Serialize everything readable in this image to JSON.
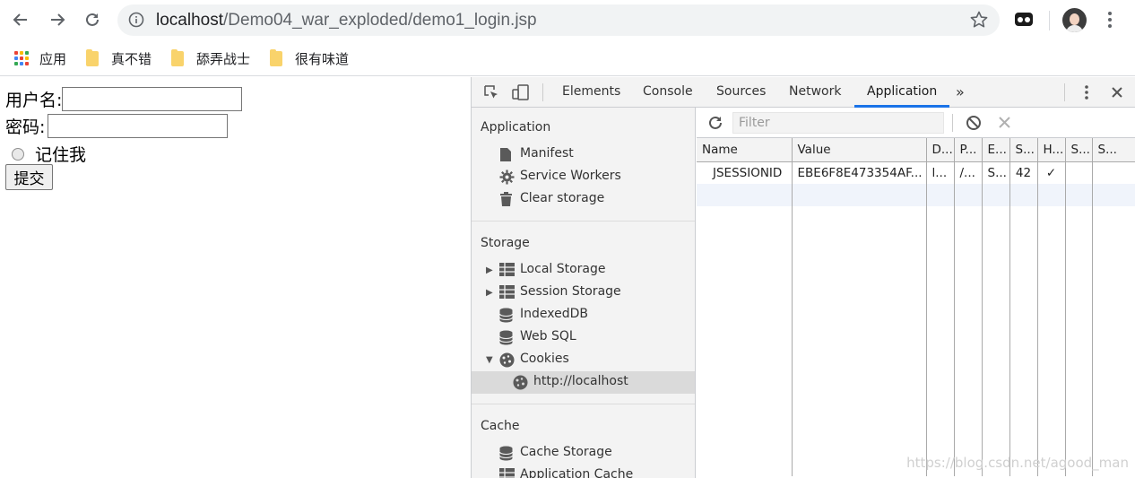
{
  "browser": {
    "url_host": "localhost",
    "url_path": "/Demo04_war_exploded/demo1_login.jsp",
    "bookmarks": [
      {
        "label": "应用",
        "icon": "apps-grid-icon"
      },
      {
        "label": "真不错",
        "icon": "folder-icon"
      },
      {
        "label": "舔弄战士",
        "icon": "folder-icon"
      },
      {
        "label": "很有味道",
        "icon": "folder-icon"
      }
    ]
  },
  "page": {
    "username_label": "用户名:",
    "password_label": "密码:",
    "remember_label": "记住我",
    "submit_label": "提交"
  },
  "devtools": {
    "tabs": [
      "Elements",
      "Console",
      "Sources",
      "Network",
      "Application"
    ],
    "active_tab": "Application",
    "sidebar": {
      "application": {
        "title": "Application",
        "items": [
          "Manifest",
          "Service Workers",
          "Clear storage"
        ]
      },
      "storage": {
        "title": "Storage",
        "items": [
          "Local Storage",
          "Session Storage",
          "IndexedDB",
          "Web SQL",
          "Cookies",
          "http://localhost"
        ]
      },
      "cache": {
        "title": "Cache",
        "items": [
          "Cache Storage",
          "Application Cache"
        ]
      }
    },
    "filter_placeholder": "Filter",
    "table": {
      "columns": [
        "Name",
        "Value",
        "D...",
        "P...",
        "E...",
        "S...",
        "H...",
        "S...",
        "S..."
      ],
      "rows": [
        [
          "JSESSIONID",
          "EBE6F8E473354AF...",
          "l...",
          "/...",
          "S...",
          "42",
          "✓",
          "",
          ""
        ]
      ]
    }
  },
  "watermark": "https://blog.csdn.net/agood_man"
}
